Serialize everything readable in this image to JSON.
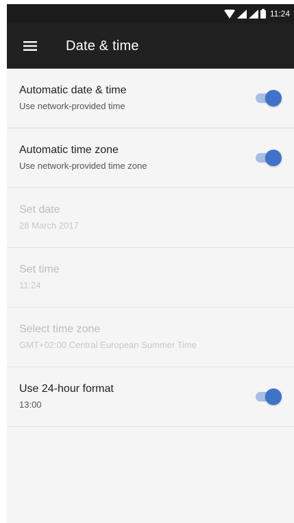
{
  "status_bar": {
    "time": "11:24",
    "icons": [
      "wifi-icon",
      "signal-icon",
      "signal-icon",
      "battery-icon"
    ]
  },
  "app_bar": {
    "menu_icon": "menu-icon",
    "title": "Date & time"
  },
  "settings": [
    {
      "title": "Automatic date & time",
      "summary": "Use network-provided time",
      "enabled": true,
      "switch_on": true
    },
    {
      "title": "Automatic time zone",
      "summary": "Use network-provided time zone",
      "enabled": true,
      "switch_on": true
    },
    {
      "title": "Set date",
      "summary": "28 March 2017",
      "enabled": false
    },
    {
      "title": "Set time",
      "summary": "11:24",
      "enabled": false
    },
    {
      "title": "Select time zone",
      "summary": "GMT+02:00 Central European Summer Time",
      "enabled": false
    },
    {
      "title": "Use 24-hour format",
      "summary": "13:00",
      "enabled": true,
      "switch_on": true
    }
  ],
  "colors": {
    "app_bar": "#212121",
    "status_bar": "#1c1c1c",
    "background": "#f5f5f5",
    "switch_on_thumb": "#3f73c9",
    "switch_on_track": "#a7bde6",
    "disabled_text": "#bdbdbd"
  }
}
